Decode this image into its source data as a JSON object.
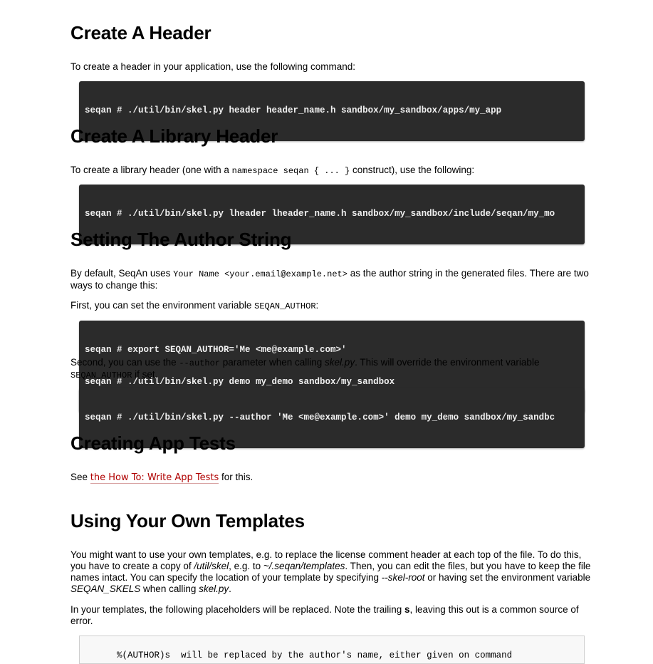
{
  "sections": {
    "header": {
      "title": "Create A Header",
      "intro": "To create a header in your application, use the following command:",
      "code": "seqan # ./util/bin/skel.py header header_name.h sandbox/my_sandbox/apps/my_app"
    },
    "library_header": {
      "title": "Create A Library Header",
      "intro_before": "To create a library header (one with a ",
      "intro_code": "namespace seqan { ... }",
      "intro_after": " construct), use the following:",
      "code": "seqan # ./util/bin/skel.py lheader lheader_name.h sandbox/my_sandbox/include/seqan/my_mo"
    },
    "author": {
      "title": "Setting The Author String",
      "p1_before": "By default, SeqAn uses ",
      "p1_code": "Your Name <your.email@example.net>",
      "p1_after": " as the author string in the generated files. There are two ways to change this:",
      "p2_before": "First, you can set the environment variable ",
      "p2_code": "SEQAN_AUTHOR",
      "p2_after": ":",
      "code_line1": "seqan # export SEQAN_AUTHOR='Me <me@example.com>'",
      "code_line2": "seqan # ./util/bin/skel.py demo my_demo sandbox/my_sandbox",
      "p3_before": "Second, you can use the ",
      "p3_code": "--author",
      "p3_mid": " parameter when calling ",
      "p3_em": "skel.py",
      "p3_after": ". This will override the environment variable ",
      "p3_code2": "SEQAN_AUTHOR",
      "p3_end": " if set.",
      "code2": "seqan # ./util/bin/skel.py --author 'Me <me@example.com>' demo my_demo sandbox/my_sandbc"
    },
    "app_tests": {
      "title": "Creating App Tests",
      "see": "See ",
      "link": "the How To: Write App Tests",
      "after": " for this."
    },
    "templates": {
      "title": "Using Your Own Templates",
      "p1_a": "You might want to use your own templates, e.g. to replace the license comment header at each top of the file. To do this, you have to create a copy of ",
      "p1_em1": "/util/skel",
      "p1_b": ", e.g. to ",
      "p1_em2": "~/.seqan/templates",
      "p1_c": ". Then, you can edit the files, but you have to keep the file names intact. You can specify the location of your template by specifying ",
      "p1_em3": "--skel-root",
      "p1_d": " or having set the environment variable ",
      "p1_em4": "SEQAN_SKELS",
      "p1_e": " when calling ",
      "p1_em5": "skel.py",
      "p1_f": ".",
      "p2_a": "In your templates, the following placeholders will be replaced. Note the trailing ",
      "p2_b": "s",
      "p2_c": ", leaving this out is a common source of error.",
      "code_line1": "%(AUTHOR)s  will be replaced by the author's name, either given on command"
    }
  }
}
